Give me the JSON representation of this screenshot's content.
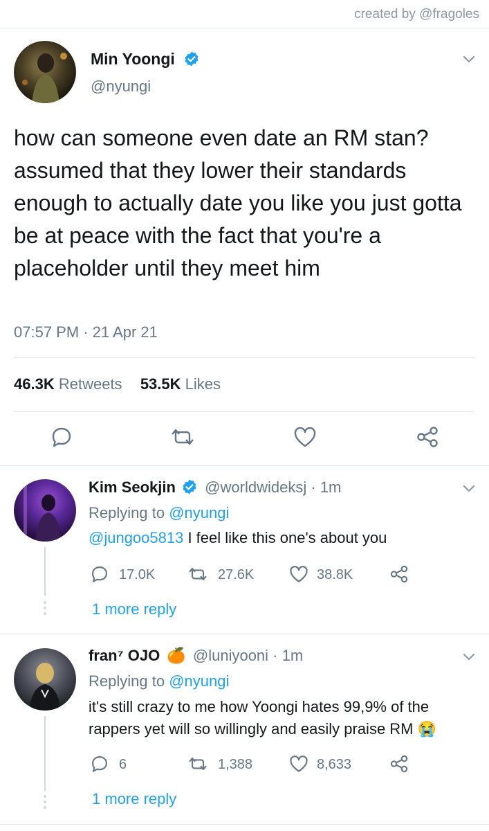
{
  "credit": "created by @fragoles",
  "main_tweet": {
    "name": "Min Yoongi",
    "handle": "@nyungi",
    "text": "how can someone even date an RM stan? assumed that they lower their standards enough to actually date you like you just gotta be at peace with the fact that you're a placeholder until they meet him",
    "timestamp": "07:57 PM · 21 Apr 21",
    "retweets_count": "46.3K",
    "retweets_label": "Retweets",
    "likes_count": "53.5K",
    "likes_label": "Likes"
  },
  "replies": [
    {
      "name": "Kim Seokjin",
      "handle_time": "@worldwideksj · 1m",
      "replying_prefix": "Replying to",
      "replying_handle": "@nyungi",
      "mention": "@jungoo5813",
      "text": " I feel like this one's about you",
      "reply_count": "17.0K",
      "retweet_count": "27.6K",
      "like_count": "38.8K",
      "more": "1 more reply"
    },
    {
      "name": "fran⁷ OJO",
      "emoji": "🍊",
      "handle_time": "@luniyooni · 1m",
      "replying_prefix": "Replying to",
      "replying_handle": "@nyungi",
      "text_line1": "it's still crazy to me how Yoongi hates 99,9% of the",
      "text_line2": "rappers yet will so willingly and easily praise RM",
      "emoji_end": "😭",
      "reply_count": "6",
      "retweet_count": "1,388",
      "like_count": "8,633",
      "more": "1 more reply"
    }
  ],
  "colors": {
    "accent": "#1da1f2",
    "muted": "#657786",
    "divider": "#e1e8ed",
    "text": "#14171a"
  }
}
